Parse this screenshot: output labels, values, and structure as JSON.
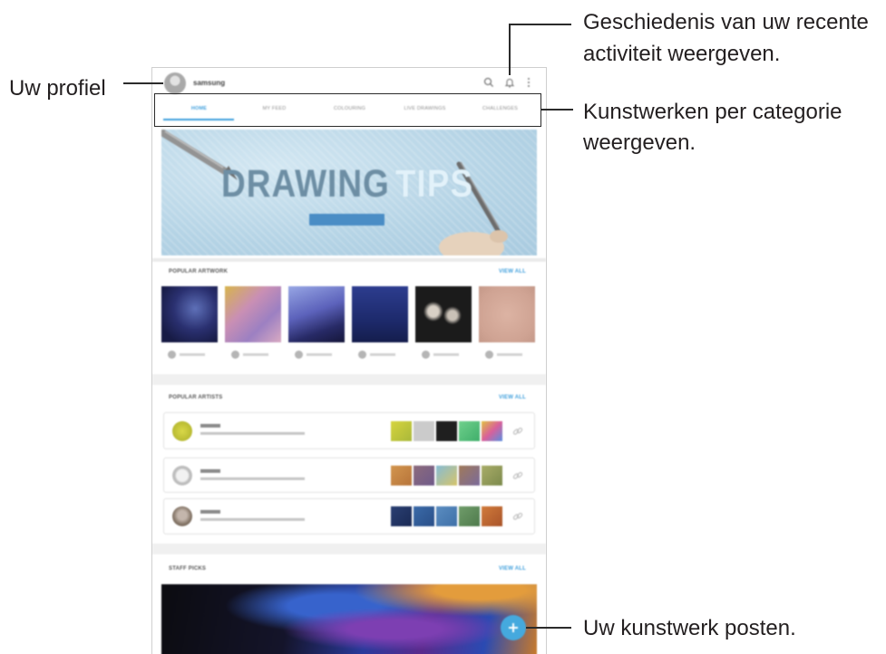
{
  "callouts": {
    "profile": "Uw profiel",
    "activity_line1": "Geschiedenis van uw recente",
    "activity_line2": "activiteit weergeven.",
    "categories_line1": "Kunstwerken per categorie",
    "categories_line2": "weergeven.",
    "post": "Uw kunstwerk posten."
  },
  "app": {
    "header": {
      "username": "samsung",
      "avatar_icon": "profile-avatar-icon",
      "search_icon": "search-icon",
      "notifications_icon": "bell-icon",
      "more_icon": "more-vertical-icon"
    },
    "tabs": [
      {
        "label": "HOME",
        "active": true
      },
      {
        "label": "MY FEED",
        "active": false
      },
      {
        "label": "COLOURING",
        "active": false
      },
      {
        "label": "LIVE DRAWINGS",
        "active": false
      },
      {
        "label": "CHALLENGES",
        "active": false
      }
    ],
    "banner": {
      "title_word_1": "DRAWING",
      "title_word_2": "TIPS"
    },
    "popular_artwork": {
      "title": "POPULAR ARTWORK",
      "view_all": "VIEW ALL"
    },
    "popular_artists": {
      "title": "POPULAR ARTISTS",
      "view_all": "VIEW ALL",
      "link_icon": "link-icon"
    },
    "staff_picks": {
      "title": "STAFF PICKS",
      "view_all": "VIEW ALL"
    },
    "fab_icon": "plus-icon"
  },
  "colors": {
    "accent": "#3f9fdc",
    "fab": "#45a9de",
    "line": "#2b2b2b"
  }
}
